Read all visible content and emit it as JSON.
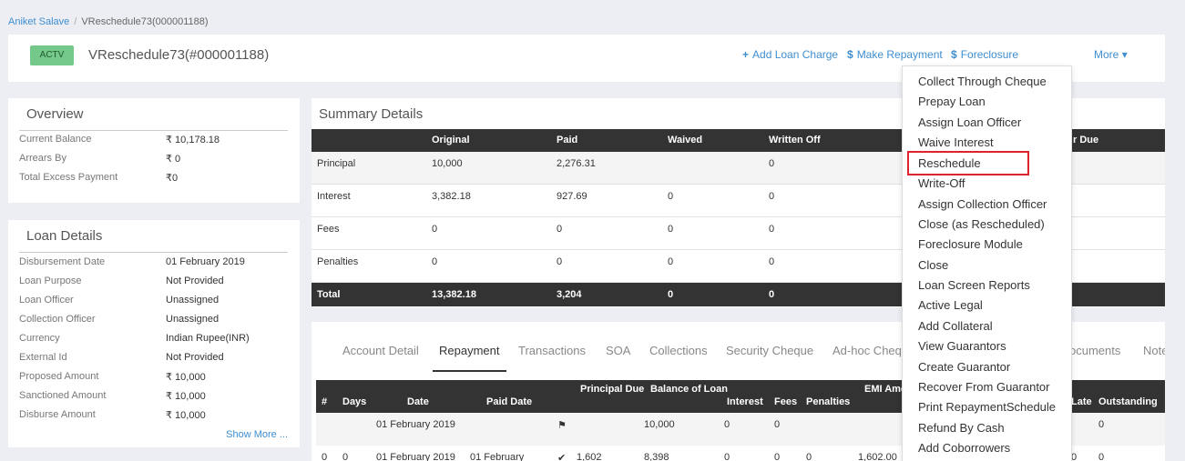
{
  "breadcrumb": {
    "link": "Aniket Salave",
    "current": "VReschedule73(000001188)"
  },
  "header": {
    "status": "ACTV",
    "title": "VReschedule73(#000001188)",
    "actions": {
      "add_charge": "Add Loan Charge",
      "make_repayment": "Make Repayment",
      "foreclosure": "Foreclosure",
      "more": "More"
    }
  },
  "overview": {
    "title": "Overview",
    "rows": [
      {
        "label": "Current Balance",
        "value": "₹ 10,178.18"
      },
      {
        "label": "Arrears By",
        "value": "₹ 0"
      },
      {
        "label": "Total Excess Payment",
        "value": "₹0"
      }
    ]
  },
  "loan_details": {
    "title": "Loan Details",
    "rows": [
      {
        "label": "Disbursement Date",
        "value": "01 February 2019"
      },
      {
        "label": "Loan Purpose",
        "value": "Not Provided"
      },
      {
        "label": "Loan Officer",
        "value": "Unassigned"
      },
      {
        "label": "Collection Officer",
        "value": "Unassigned"
      },
      {
        "label": "Currency",
        "value": "Indian Rupee(INR)"
      },
      {
        "label": "External Id",
        "value": "Not Provided"
      },
      {
        "label": "Proposed Amount",
        "value": "₹ 10,000"
      },
      {
        "label": "Sanctioned Amount",
        "value": "₹ 10,000"
      },
      {
        "label": "Disburse Amount",
        "value": "₹ 10,000"
      }
    ],
    "show_more": "Show More ..."
  },
  "summary": {
    "title": "Summary Details",
    "columns": [
      "Original",
      "Paid",
      "Waived",
      "Written Off",
      "r Due"
    ],
    "rows": [
      {
        "label": "Principal",
        "original": "10,000",
        "paid": "2,276.31",
        "waived": "",
        "written_off": "0"
      },
      {
        "label": "Interest",
        "original": "3,382.18",
        "paid": "927.69",
        "waived": "0",
        "written_off": "0"
      },
      {
        "label": "Fees",
        "original": "0",
        "paid": "0",
        "waived": "0",
        "written_off": "0"
      },
      {
        "label": "Penalties",
        "original": "0",
        "paid": "0",
        "waived": "0",
        "written_off": "0"
      }
    ],
    "total": {
      "label": "Total",
      "original": "13,382.18",
      "paid": "3,204",
      "waived": "0",
      "written_off": "0"
    }
  },
  "tabs": [
    "Account Detail",
    "Repayment",
    "Transactions",
    "SOA",
    "Collections",
    "Security Cheque",
    "Ad-hoc Cheq",
    "ocuments",
    "Note"
  ],
  "repayment": {
    "columns": [
      "#",
      "Days",
      "Date",
      "Paid Date",
      "Principal Due",
      "Balance of Loan",
      "Interest",
      "Fees",
      "Penalties",
      "EMI Amount",
      "Late",
      "Outstanding"
    ],
    "rows": [
      {
        "num": "",
        "days": "",
        "date": "01 February 2019",
        "paid_date": "",
        "principal": "",
        "balance": "10,000",
        "interest": "0",
        "fees": "0",
        "penalties": "",
        "emi": "",
        "late": "",
        "outstanding": "0"
      },
      {
        "num": "0",
        "days": "0",
        "date": "01 February 2019",
        "paid_date": "01 February",
        "principal": "1,602",
        "balance": "8,398",
        "interest": "0",
        "fees": "0",
        "penalties": "0",
        "emi": "1,602.00",
        "late": "0",
        "outstanding": "0"
      }
    ]
  },
  "more_menu": [
    "Collect Through Cheque",
    "Prepay Loan",
    "Assign Loan Officer",
    "Waive Interest",
    "Reschedule",
    "Write-Off",
    "Assign Collection Officer",
    "Close (as Rescheduled)",
    "Foreclosure Module",
    "Close",
    "Loan Screen Reports",
    "Active Legal",
    "Add Collateral",
    "View Guarantors",
    "Create Guarantor",
    "Recover From Guarantor",
    "Print RepaymentSchedule",
    "Refund By Cash",
    "Add Coborrowers"
  ],
  "colors": {
    "accent": "#3e8ed0",
    "badge": "#74c98a",
    "dark": "#333333",
    "highlight": "#e0222f"
  }
}
